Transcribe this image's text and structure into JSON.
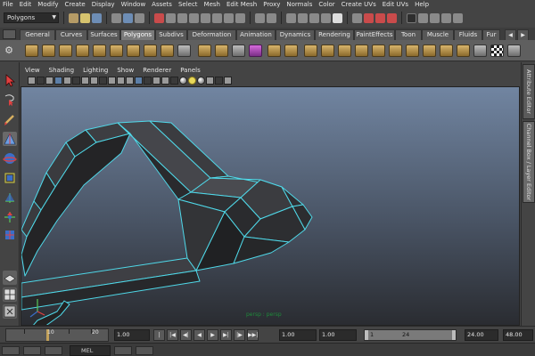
{
  "menubar": {
    "items": [
      "File",
      "Edit",
      "Modify",
      "Create",
      "Display",
      "Window",
      "Assets",
      "Select",
      "Mesh",
      "Edit Mesh",
      "Proxy",
      "Normals",
      "Color",
      "Create UVs",
      "Edit UVs",
      "Help"
    ]
  },
  "statusline": {
    "mode": "Polygons"
  },
  "shelf": {
    "tabs": [
      "General",
      "Curves",
      "Surfaces",
      "Polygons",
      "Subdivs",
      "Deformation",
      "Animation",
      "Dynamics",
      "Rendering",
      "PaintEffects",
      "Toon",
      "Muscle",
      "Fluids",
      "Fur"
    ],
    "active_tab": "Polygons"
  },
  "viewpanel": {
    "menus": [
      "View",
      "Shading",
      "Lighting",
      "Show",
      "Renderer",
      "Panels"
    ],
    "camera_label": "persp : persp"
  },
  "sidepanel": {
    "attribute_editor": "Attribute Editor",
    "channel_box": "Channel Box / Layer Editor"
  },
  "timeslider": {
    "tick_labels": [
      "10",
      "20"
    ],
    "current_time": "1.00",
    "playback_start": "1.00",
    "range_start": "1.00",
    "range_min": "1",
    "range_max": "24",
    "end_time": "24.00",
    "playback_end": "48.00",
    "playback_buttons": [
      "|◀◀",
      "|◀",
      "◀|",
      "◀",
      "▶",
      "▶|",
      "|▶",
      "▶▶|"
    ]
  },
  "bottombar": {
    "mel_label": "MEL"
  },
  "colors": {
    "ui_background": "#444444",
    "viewport_top": "#7185a1",
    "viewport_bottom": "#2a2c31",
    "wireframe": "#4fd8e8",
    "mesh_face": "#2b2b2d",
    "active_tab": "#7a7a7a"
  }
}
